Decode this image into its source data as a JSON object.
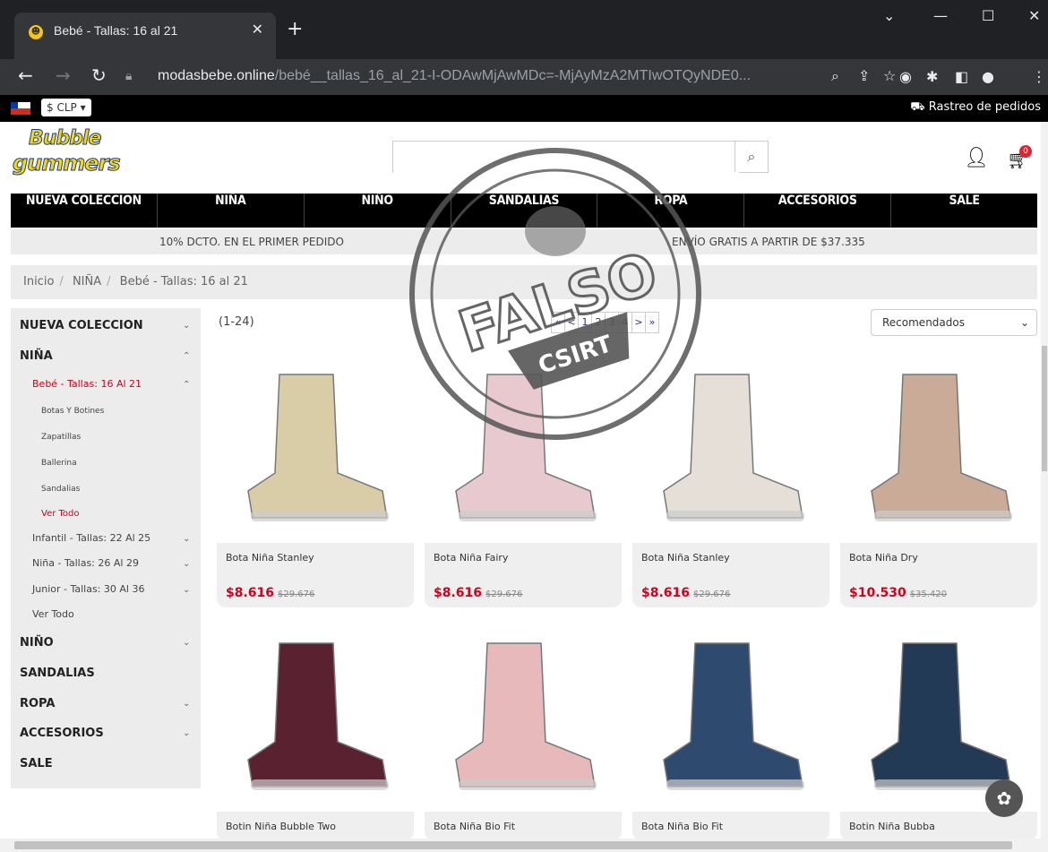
{
  "browser": {
    "tab_title": "Bebé - Tallas: 16 al 21",
    "url_domain": "modasbebe.online",
    "url_path": "/bebé__tallas_16_al_21-I-ODAwMjAwMDc=-MjAyMzA2MTIwOTQyNDE0..."
  },
  "topbar": {
    "currency": "$ CLP ▾",
    "tracking": "⛟ Rastreo de pedidos"
  },
  "logo": {
    "line1": "Bubble",
    "line2": "gummers"
  },
  "header": {
    "cart_count": "0"
  },
  "nav": [
    "NUEVA COLECCION",
    "NIÑA",
    "NIÑO",
    "SANDALIAS",
    "ROPA",
    "ACCESORIOS",
    "SALE"
  ],
  "promo": {
    "left": "10% DCTO. EN EL PRIMER PEDIDO",
    "right": "ENVÍO GRATIS A PARTIR DE $37.335"
  },
  "breadcrumb": [
    "Inicio",
    "NIÑA",
    "Bebé - Tallas: 16 al 21"
  ],
  "sidebar": {
    "nueva": "NUEVA COLECCION",
    "nina": "NIÑA",
    "bebe": "Bebé - Tallas: 16 Al 21",
    "botas": "Botas Y Botines",
    "zapatillas": "Zapatillas",
    "ballerina": "Ballerina",
    "sandalias_sub": "Sandalias",
    "ver_todo_red": "Ver Todo",
    "infantil": "Infantil - Tallas: 22 Al 25",
    "nina2": "Niña - Tallas: 26 Al 29",
    "junior": "Junior - Tallas: 30 Al 36",
    "ver_todo": "Ver Todo",
    "nino": "NIÑO",
    "sandalias": "SANDALIAS",
    "ropa": "ROPA",
    "accesorios": "ACCESORIOS",
    "sale": "SALE"
  },
  "listing": {
    "count": "(1-24)",
    "pages": [
      "«",
      "<",
      "1",
      "2",
      "3",
      "4",
      ">",
      "»"
    ],
    "sort": "Recomendados"
  },
  "stamp": {
    "word": "FALSO",
    "org": "CSIRT"
  },
  "products": [
    {
      "name": "Bota Niña Stanley",
      "price": "$8.616",
      "old": "$29.676",
      "color": "#d9cda8"
    },
    {
      "name": "Bota Niña Fairy",
      "price": "$8.616",
      "old": "$29.676",
      "color": "#e8c9d0"
    },
    {
      "name": "Bota Niña Stanley",
      "price": "$8.616",
      "old": "$29.676",
      "color": "#e6dfd8"
    },
    {
      "name": "Bota Niña Dry",
      "price": "$10.530",
      "old": "$35.420",
      "color": "#c9ab98"
    },
    {
      "name": "Botin Niña Bubble Two",
      "price": "",
      "old": "",
      "color": "#5a2230"
    },
    {
      "name": "Bota Niña Bio Fit",
      "price": "",
      "old": "",
      "color": "#e7b9bb"
    },
    {
      "name": "Bota Niña Bio Fit",
      "price": "",
      "old": "",
      "color": "#2e4a6e"
    },
    {
      "name": "Botin Niña Bubba",
      "price": "",
      "old": "",
      "color": "#233a56"
    }
  ]
}
